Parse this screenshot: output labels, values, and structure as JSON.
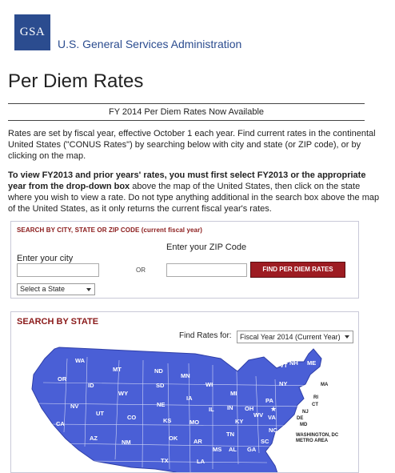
{
  "header": {
    "logo_text": "GSA",
    "agency_name": "U.S. General Services Administration"
  },
  "page_title": "Per Diem Rates",
  "banner": "FY 2014 Per Diem Rates Now Available",
  "intro": "Rates are set by fiscal year, effective October 1 each year. Find current rates in the continental United States (\"CONUS Rates\") by searching below with city and state (or ZIP code), or by clicking on the map.",
  "instructions": {
    "bold": "To view FY2013 and prior years' rates, you must first select FY2013 or the appropriate year from the drop-down box",
    "rest": " above the map of the United States, then click on the state where you wish to view a rate. Do not type anything additional in the search box above the map of the United States, as it only returns the current fiscal year's rates."
  },
  "search": {
    "title": "SEARCH BY CITY, STATE OR ZIP CODE (current fiscal year)",
    "city_label": "Enter your city",
    "city_value": "",
    "state_select": "Select a State",
    "or_label": "OR",
    "zip_label": "Enter your ZIP Code",
    "zip_value": "",
    "button_label": "FIND PER DIEM RATES"
  },
  "state_search": {
    "title": "SEARCH BY STATE",
    "find_rates_label": "Find Rates for:",
    "fiscal_year_selected": "Fiscal Year 2014 (Current Year)",
    "map_fill": "#4a5fd6",
    "states": [
      "WA",
      "MT",
      "ND",
      "MN",
      "OR",
      "ID",
      "SD",
      "WI",
      "MI",
      "NY",
      "VT",
      "NH",
      "ME",
      "MA",
      "RI",
      "CT",
      "NJ",
      "DE",
      "MD",
      "WY",
      "NE",
      "IA",
      "PA",
      "OH",
      "IL",
      "IN",
      "WV",
      "VA",
      "NV",
      "UT",
      "CO",
      "KS",
      "MO",
      "KY",
      "CA",
      "AZ",
      "NM",
      "OK",
      "AR",
      "TN",
      "NC",
      "SC",
      "TX",
      "LA",
      "MS",
      "AL",
      "GA"
    ],
    "dc_label": "WASHINGTON, DC METRO AREA"
  }
}
